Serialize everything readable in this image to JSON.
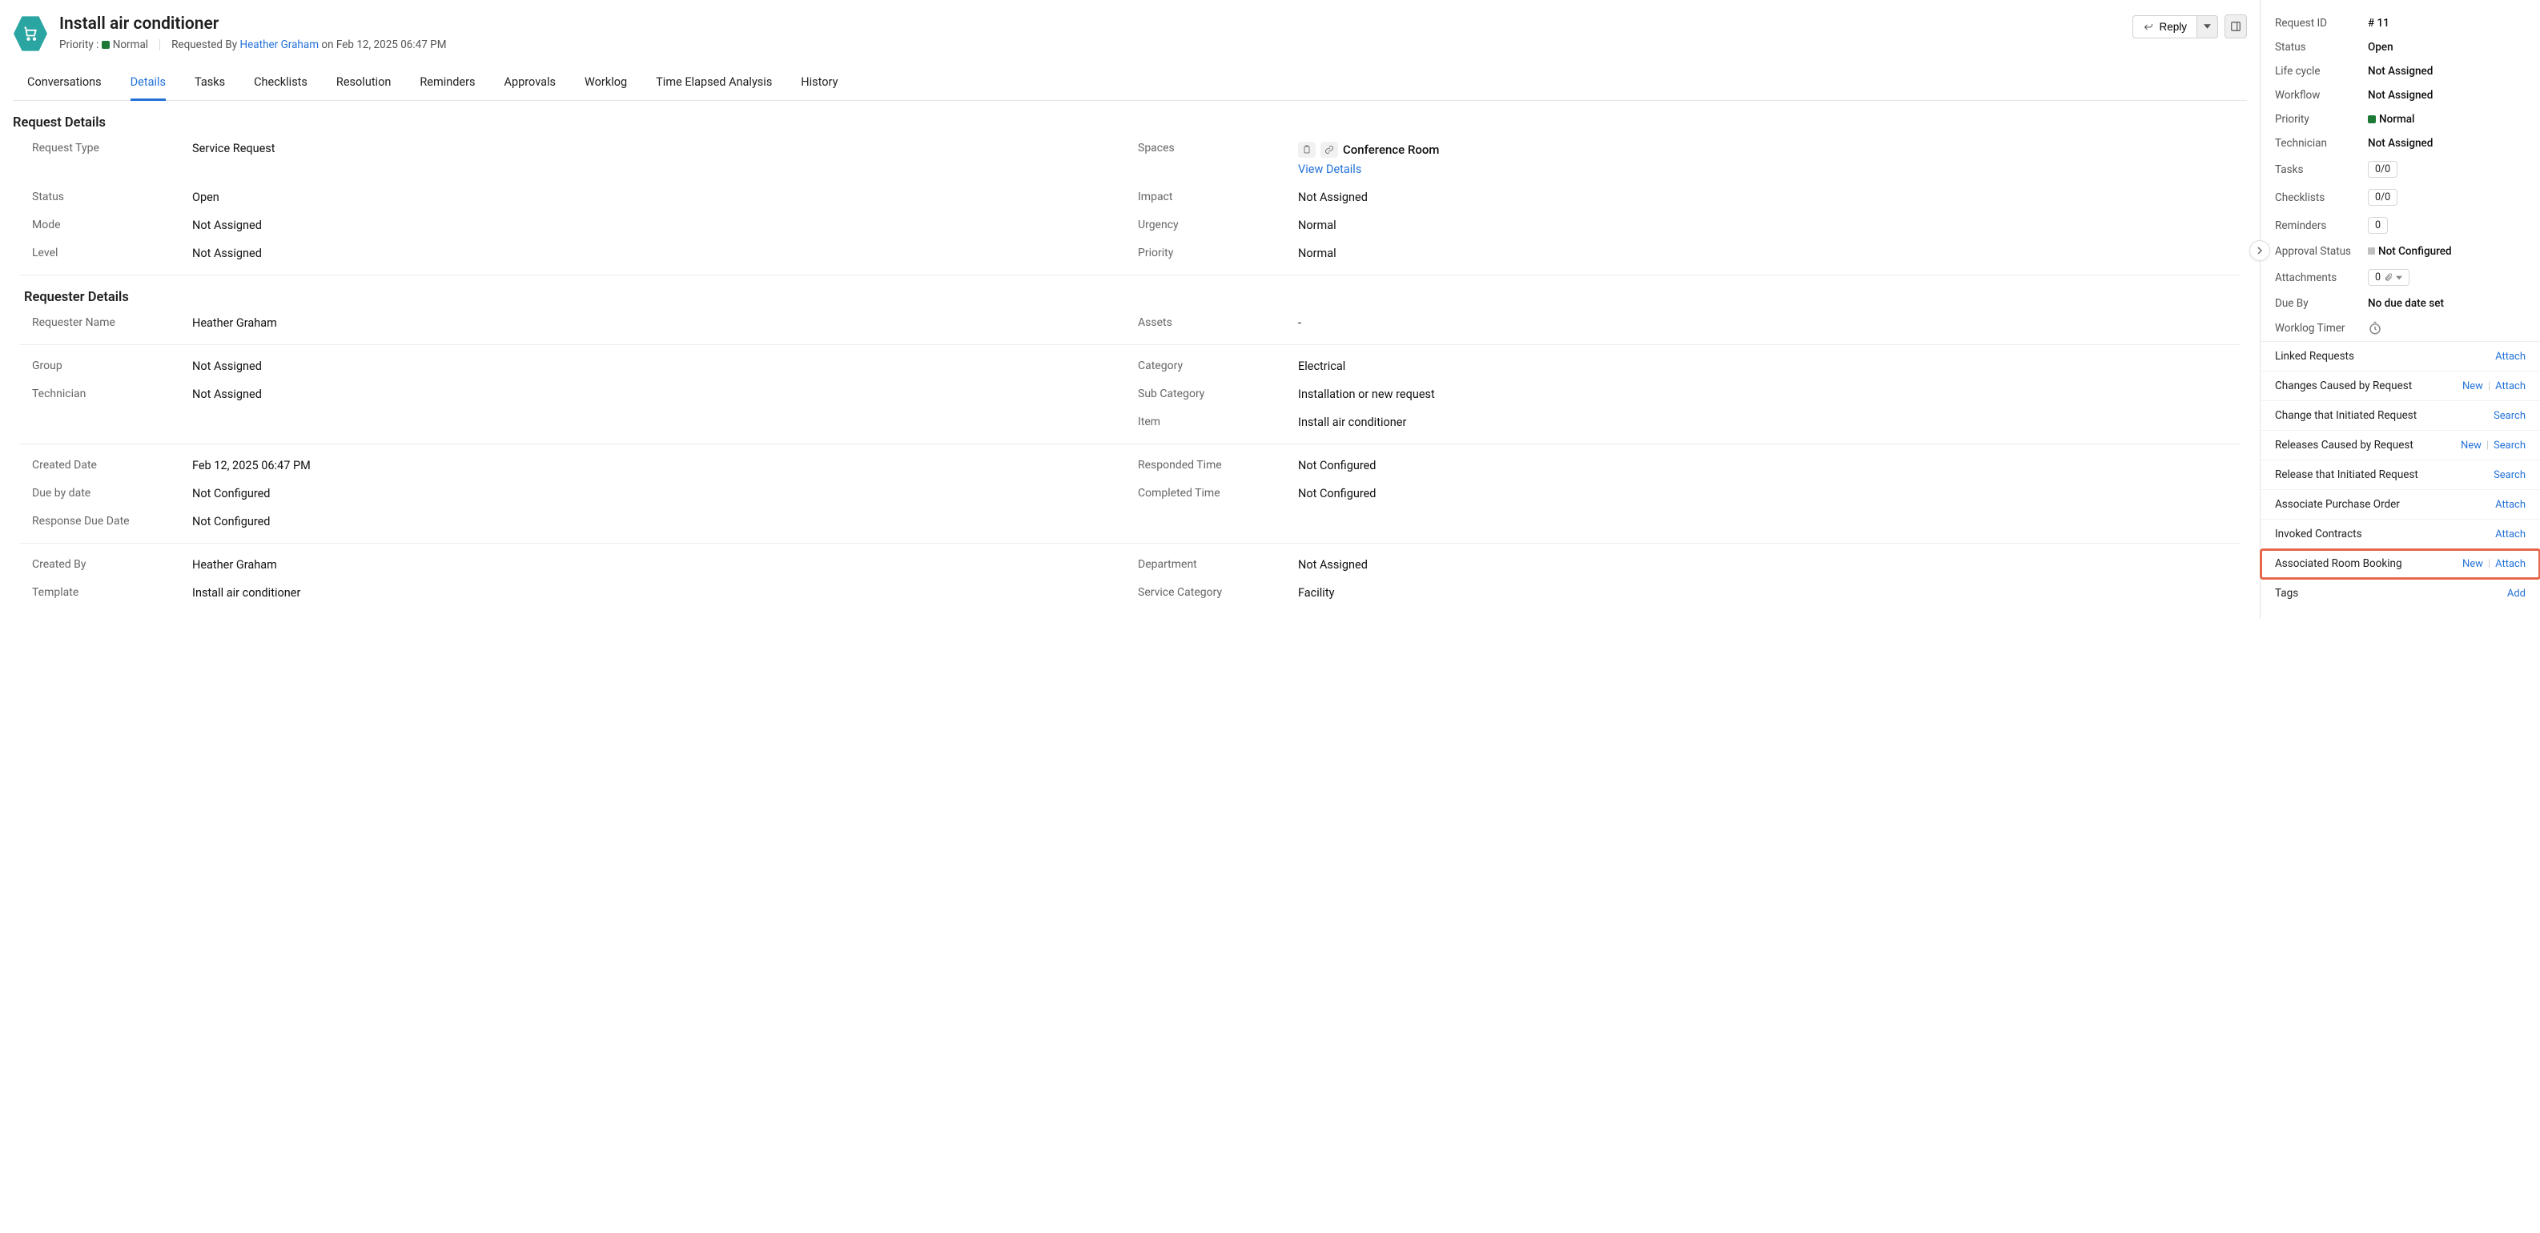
{
  "header": {
    "title": "Install air conditioner",
    "priority_label": "Priority :",
    "priority_value": "Normal",
    "priority_color": "#1c7a36",
    "requested_by_label": "Requested By",
    "requested_by": "Heather Graham",
    "requested_on": "on Feb 12, 2025 06:47 PM",
    "reply_label": "Reply"
  },
  "tabs": [
    {
      "label": "Conversations",
      "active": false
    },
    {
      "label": "Details",
      "active": true
    },
    {
      "label": "Tasks",
      "active": false
    },
    {
      "label": "Checklists",
      "active": false
    },
    {
      "label": "Resolution",
      "active": false
    },
    {
      "label": "Reminders",
      "active": false
    },
    {
      "label": "Approvals",
      "active": false
    },
    {
      "label": "Worklog",
      "active": false
    },
    {
      "label": "Time Elapsed Analysis",
      "active": false
    },
    {
      "label": "History",
      "active": false
    }
  ],
  "sections": {
    "request_details_title": "Request Details",
    "requester_details_title": "Requester Details",
    "fields": {
      "request_type": {
        "label": "Request Type",
        "value": "Service Request"
      },
      "spaces": {
        "label": "Spaces",
        "value": "Conference Room",
        "view_details": "View Details"
      },
      "status": {
        "label": "Status",
        "value": "Open"
      },
      "impact": {
        "label": "Impact",
        "value": "Not Assigned"
      },
      "mode": {
        "label": "Mode",
        "value": "Not Assigned"
      },
      "urgency": {
        "label": "Urgency",
        "value": "Normal"
      },
      "level": {
        "label": "Level",
        "value": "Not Assigned"
      },
      "priority": {
        "label": "Priority",
        "value": "Normal"
      },
      "requester_name": {
        "label": "Requester Name",
        "value": "Heather Graham"
      },
      "assets": {
        "label": "Assets",
        "value": "-"
      },
      "group": {
        "label": "Group",
        "value": "Not Assigned"
      },
      "category": {
        "label": "Category",
        "value": "Electrical"
      },
      "technician": {
        "label": "Technician",
        "value": "Not Assigned"
      },
      "sub_category": {
        "label": "Sub Category",
        "value": "Installation or new request"
      },
      "item": {
        "label": "Item",
        "value": "Install air conditioner"
      },
      "created_date": {
        "label": "Created Date",
        "value": "Feb 12, 2025 06:47 PM"
      },
      "responded_time": {
        "label": "Responded Time",
        "value": "Not Configured"
      },
      "due_by_date": {
        "label": "Due by date",
        "value": "Not Configured"
      },
      "completed_time": {
        "label": "Completed Time",
        "value": "Not Configured"
      },
      "response_due_date": {
        "label": "Response Due Date",
        "value": "Not Configured"
      },
      "created_by": {
        "label": "Created By",
        "value": "Heather Graham"
      },
      "department": {
        "label": "Department",
        "value": "Not Assigned"
      },
      "template": {
        "label": "Template",
        "value": "Install air conditioner"
      },
      "service_category": {
        "label": "Service Category",
        "value": "Facility"
      }
    }
  },
  "sidebar": {
    "rows": {
      "request_id": {
        "label": "Request ID",
        "value": "# 11"
      },
      "status": {
        "label": "Status",
        "value": "Open"
      },
      "life_cycle": {
        "label": "Life cycle",
        "value": "Not Assigned"
      },
      "workflow": {
        "label": "Workflow",
        "value": "Not Assigned"
      },
      "priority": {
        "label": "Priority",
        "value": "Normal"
      },
      "technician": {
        "label": "Technician",
        "value": "Not Assigned"
      },
      "tasks": {
        "label": "Tasks",
        "value": "0/0"
      },
      "checklists": {
        "label": "Checklists",
        "value": "0/0"
      },
      "reminders": {
        "label": "Reminders",
        "value": "0"
      },
      "approval_status": {
        "label": "Approval Status",
        "value": "Not Configured"
      },
      "attachments": {
        "label": "Attachments",
        "value": "0"
      },
      "due_by": {
        "label": "Due By",
        "value": "No due date set"
      },
      "worklog_timer": {
        "label": "Worklog Timer",
        "value": ""
      }
    },
    "sections": [
      {
        "title": "Linked Requests",
        "actions": [
          "Attach"
        ]
      },
      {
        "title": "Changes Caused by Request",
        "actions": [
          "New",
          "Attach"
        ]
      },
      {
        "title": "Change that Initiated Request",
        "actions": [
          "Search"
        ]
      },
      {
        "title": "Releases Caused by Request",
        "actions": [
          "New",
          "Search"
        ]
      },
      {
        "title": "Release that Initiated Request",
        "actions": [
          "Search"
        ]
      },
      {
        "title": "Associate Purchase Order",
        "actions": [
          "Attach"
        ]
      },
      {
        "title": "Invoked Contracts",
        "actions": [
          "Attach"
        ]
      },
      {
        "title": "Associated Room Booking",
        "actions": [
          "New",
          "Attach"
        ],
        "highlight": true
      },
      {
        "title": "Tags",
        "actions": [
          "Add"
        ]
      }
    ]
  }
}
